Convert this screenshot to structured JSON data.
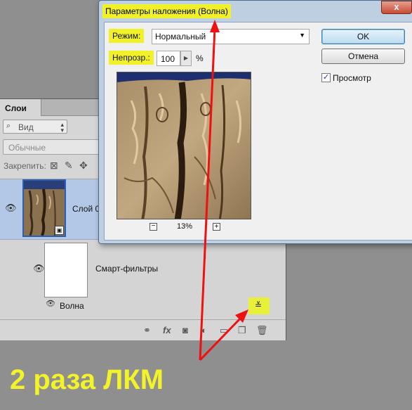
{
  "layers_panel": {
    "tab_label": "Слои",
    "filter_kind": "Вид",
    "blend_mode": "Обычные",
    "lock_label": "Закрепить:",
    "layer_name": "Слой 0",
    "smart_filters_label": "Смарт-фильтры",
    "filter_name": "Волна"
  },
  "dialog": {
    "title": "Параметры наложения (Волна)",
    "close_glyph": "x",
    "mode_label": "Режим:",
    "mode_value": "Нормальный",
    "opacity_label": "Непрозр.:",
    "opacity_value": "100",
    "opacity_unit": "%",
    "zoom_out": "−",
    "zoom_level": "13%",
    "zoom_in": "+",
    "ok_label": "OK",
    "cancel_label": "Отмена",
    "preview_label": "Просмотр",
    "preview_checked": true
  },
  "annotation": {
    "text": "2 раза ЛКМ",
    "highlight_color": "#f1f12a",
    "arrow_color": "#ee1111"
  },
  "icons": [
    "eye-icon",
    "search-icon",
    "lock-icon",
    "brush-icon",
    "move-icon",
    "link-icon",
    "fx-icon",
    "mask-icon",
    "adjustment-icon",
    "folder-icon",
    "new-layer-icon",
    "trash-icon",
    "filter-options-icon",
    "smart-object-icon"
  ]
}
